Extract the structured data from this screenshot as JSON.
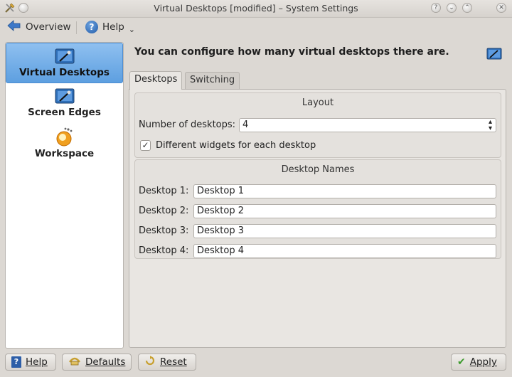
{
  "window": {
    "title": "Virtual Desktops [modified] – System Settings"
  },
  "toolbar": {
    "overview_label": "Overview",
    "help_label": "Help"
  },
  "sidebar": {
    "items": [
      {
        "label": "Virtual Desktops",
        "icon": "virtual-desktops-icon",
        "selected": true
      },
      {
        "label": "Screen Edges",
        "icon": "screen-edges-icon",
        "selected": false
      },
      {
        "label": "Workspace",
        "icon": "workspace-icon",
        "selected": false
      }
    ]
  },
  "main": {
    "header": "You can configure how many virtual desktops there are.",
    "tabs": [
      {
        "label": "Desktops",
        "active": true
      },
      {
        "label": "Switching",
        "active": false
      }
    ],
    "layout_group": {
      "title": "Layout",
      "num_desktops_label": "Number of desktops:",
      "num_desktops_value": "4",
      "different_widgets_label": "Different widgets for each desktop",
      "different_widgets_checked": true
    },
    "names_group": {
      "title": "Desktop Names",
      "rows": [
        {
          "label": "Desktop 1:",
          "value": "Desktop 1"
        },
        {
          "label": "Desktop 2:",
          "value": "Desktop 2"
        },
        {
          "label": "Desktop 3:",
          "value": "Desktop 3"
        },
        {
          "label": "Desktop 4:",
          "value": "Desktop 4"
        }
      ]
    }
  },
  "footer": {
    "help_label": "Help",
    "defaults_label": "Defaults",
    "reset_label": "Reset",
    "apply_label": "Apply"
  },
  "colors": {
    "selection": "#6aa6e6",
    "apply_check": "#3c9a2c"
  }
}
